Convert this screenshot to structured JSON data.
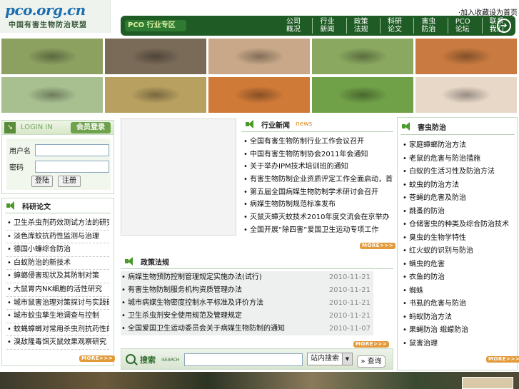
{
  "header": {
    "logo_main": "pco.org.cn",
    "logo_sub": "中国有害生物防治联盟",
    "favorite": "·加入收藏设为首页"
  },
  "nav": {
    "brand": "PCO 行业专区",
    "items": [
      "公司概况",
      "行业新闻",
      "政策法规",
      "科研论文",
      "害虫防治",
      "PCO论坛",
      "联系我们"
    ],
    "arrow_icon": "arrow-right-icon"
  },
  "photos": [
    {
      "name": "cockroach-photo",
      "color": "#8ca060"
    },
    {
      "name": "mice-photo",
      "color": "#7a6a58"
    },
    {
      "name": "mosquito-photo",
      "color": "#c8a888"
    },
    {
      "name": "fly-photo",
      "color": "#8aa860"
    },
    {
      "name": "spider-photo",
      "color": "#c87a40"
    },
    {
      "name": "ant-photo",
      "color": "#a8c090"
    },
    {
      "name": "mites-photo",
      "color": "#b8a060"
    },
    {
      "name": "mite-red-photo",
      "color": "#d07a38"
    },
    {
      "name": "beetle-photo",
      "color": "#70a048"
    },
    {
      "name": "flea-photo",
      "color": "#e8d8c8"
    }
  ],
  "login": {
    "title_en": "LOGIN IN",
    "title_cn": "会员登录",
    "username_label": "用户名",
    "password_label": "密码",
    "login_button": "登陆",
    "register_button": "注册"
  },
  "research": {
    "title": "科研论文",
    "items": [
      "卫生杀虫剂药效测试方法的研究",
      "淡色库蚊抗药性监测与治理",
      "德国小蠊综合防治",
      "白蚁防治的新技术",
      "蟑螂侵害现状及其防制对策",
      "大鼠胃内NK细胞的活性研究",
      "城市鼠害治理对策探讨与实践研究",
      "城市蚊虫孳生地调查与控制",
      "蚊蝇蟑螂对常用杀虫剂抗药性的研究",
      "溴敌隆毒饵灭鼠效果观察研究"
    ],
    "more": "MORE>>>"
  },
  "news": {
    "title": "行业新闻",
    "title_en": "news",
    "items": [
      "全国有害生物防制行业工作会议召开",
      "中国有害生物防制协会2011年会通知",
      "关于举办IPM技术培训班的通知",
      "有害生物防制企业资质评定工作全面启动，首批入选企业名单公布…",
      "第五届全国病媒生物防制学术研讨会召开",
      "病媒生物防制规范标准发布",
      "灭鼠灭蟑灭蚊技术2010年度交流会在京举办",
      "全国开展“除四害”爱国卫生运动专项工作"
    ],
    "more": "MORE>>>"
  },
  "policy": {
    "title": "政策法规",
    "items": [
      {
        "title": "病媒生物预防控制管理规定实施办法(试行)",
        "date": "2010-11-21"
      },
      {
        "title": "有害生物防制服务机构资质管理办法",
        "date": "2010-11-21"
      },
      {
        "title": "城市病媒生物密度控制水平标准及评价方法",
        "date": "2010-11-21"
      },
      {
        "title": "卫生杀虫剂安全使用规范及管理规定",
        "date": "2010-11-21"
      },
      {
        "title": "全国爱国卫生运动委员会关于病媒生物防制的通知",
        "date": "2010-11-07"
      }
    ],
    "more": "MORE>>>"
  },
  "pests": {
    "title": "害虫防治",
    "items": [
      "家庭蟑螂防治方法",
      "老鼠的危害与防治措施",
      "白蚁的生活习性及防治方法",
      "蚊虫的防治方法",
      "苍蝇的危害及防治",
      "跳蚤的防治",
      "仓储害虫的种类及综合防治技术",
      "臭虫的生物学特性",
      "红火蚁的识别与防治",
      "螨虫的危害",
      "衣鱼的防治",
      "蜘蛛",
      "书虱的危害与防治",
      "蚂蚁防治方法",
      "果蝇防治 蛾蠓防治",
      "鼠害治理"
    ],
    "more": "MORE>>>"
  },
  "search": {
    "label": "搜索",
    "label_en": ":SEARCH",
    "select_value": "站内搜索",
    "button": "查询"
  },
  "colors": {
    "nav_bg": "#1f5b24",
    "accent_green": "#4a9a2a",
    "more_orange": "#e39a3b",
    "logo_blue": "#1e6fb0"
  }
}
